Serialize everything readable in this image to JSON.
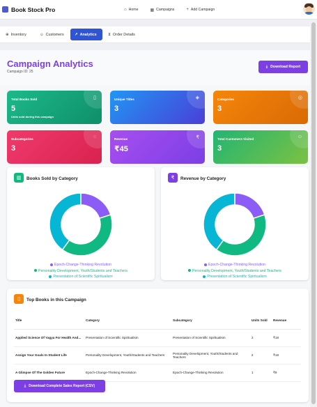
{
  "brand": {
    "name": "Book Stock Pro"
  },
  "nav": {
    "home": "Home",
    "campaigns": "Campaigns",
    "add_campaign": "Add Campaign"
  },
  "tabs": [
    {
      "label": "Inventory"
    },
    {
      "label": "Customers"
    },
    {
      "label": "Analytics"
    },
    {
      "label": "Order Details"
    }
  ],
  "header": {
    "title": "Campaign Analytics",
    "campaign_id": "Campaign ID: 25",
    "download_label": "Download Report"
  },
  "cards": [
    {
      "title": "Total Books Sold",
      "value": "5",
      "sub": "Units sold during this campaign",
      "color1": "#1db98a",
      "color2": "#0f8f6a"
    },
    {
      "title": "Unique Titles",
      "value": "3",
      "sub": "",
      "color1": "#2196f3",
      "color2": "#4a3fd8"
    },
    {
      "title": "Categories",
      "value": "3",
      "sub": "",
      "color1": "#f5860a",
      "color2": "#d96a05"
    },
    {
      "title": "Subcategories",
      "value": "3",
      "sub": "",
      "color1": "#ef3a6c",
      "color2": "#d9224f"
    },
    {
      "title": "Revenue",
      "value": "₹45",
      "sub": "",
      "color1": "#a84ef0",
      "color2": "#7b3fe4"
    },
    {
      "title": "Total Customers Visited",
      "value": "3",
      "sub": "",
      "color1": "#22b573",
      "color2": "#7cc142"
    }
  ],
  "books_chart": {
    "title": "Books Sold by Category",
    "chart_data": {
      "type": "pie",
      "donut": true,
      "categories": [
        "Epoch-Change-Thinking Revolution",
        "Personality Development, Youth/Students and Teachers",
        "Presentation of Scientific Spiritualism"
      ],
      "values": [
        1,
        2,
        2
      ],
      "colors": [
        "#8b5cf6",
        "#10b981",
        "#06b6d4"
      ]
    }
  },
  "revenue_chart": {
    "title": "Revenue by Category",
    "chart_data": {
      "type": "pie",
      "donut": true,
      "categories": [
        "Epoch-Change-Thinking Revolution",
        "Personality Development, Youth/Students and Teachers",
        "Presentation of Scientific Spiritualism"
      ],
      "values": [
        9,
        18,
        18
      ],
      "colors": [
        "#8b5cf6",
        "#10b981",
        "#06b6d4"
      ]
    }
  },
  "top_books": {
    "title": "Top Books in this Campaign",
    "columns": [
      "Title",
      "Category",
      "Subcategory",
      "Units Sold",
      "Revenue"
    ],
    "rows": [
      [
        "Applied Science Of Yagya For Health And...",
        "Presentation of Scientific Spiritualism",
        "Presentation of Scientific Spiritualism",
        "2",
        "₹18"
      ],
      [
        "Assign Your Goals In Student Life",
        "Personality Development, Youth/Students and Teachers",
        "Personality Development, Youth/Students and Teachers",
        "2",
        "₹18"
      ],
      [
        "A Glimpse Of The Golden Future",
        "Epoch-Change-Thinking Revolution",
        "Epoch-Change-Thinking Revolution",
        "1",
        "₹9"
      ]
    ],
    "csv_label": "Download Complete Sales Report (CSV)"
  }
}
